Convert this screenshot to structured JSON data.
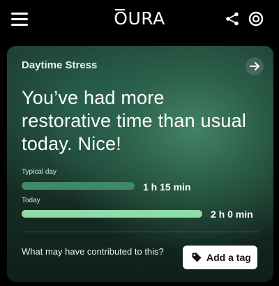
{
  "header": {
    "logo_text": "OURA"
  },
  "card": {
    "title": "Daytime Stress",
    "headline": "You’ve had more restorative time than usual today. Nice!",
    "bars": [
      {
        "label": "Typical day",
        "value": "1 h 15 min",
        "fill_fraction": 0.47,
        "color": "#3f8a66"
      },
      {
        "label": "Today",
        "value": "2 h 0 min",
        "fill_fraction": 0.75,
        "color": "#8fdcaa"
      }
    ],
    "prompt": "What may have contributed to this?",
    "tag_button_label": "Add a tag"
  },
  "icons": {
    "menu": "hamburger-menu-icon",
    "share": "share-icon",
    "ring": "oura-ring-icon",
    "arrow": "arrow-right-icon",
    "tag": "tag-icon"
  },
  "colors": {
    "background": "#000000",
    "card_gradient_center": "#46876a",
    "bar_typical": "#3f8a66",
    "bar_today": "#8fdcaa"
  }
}
